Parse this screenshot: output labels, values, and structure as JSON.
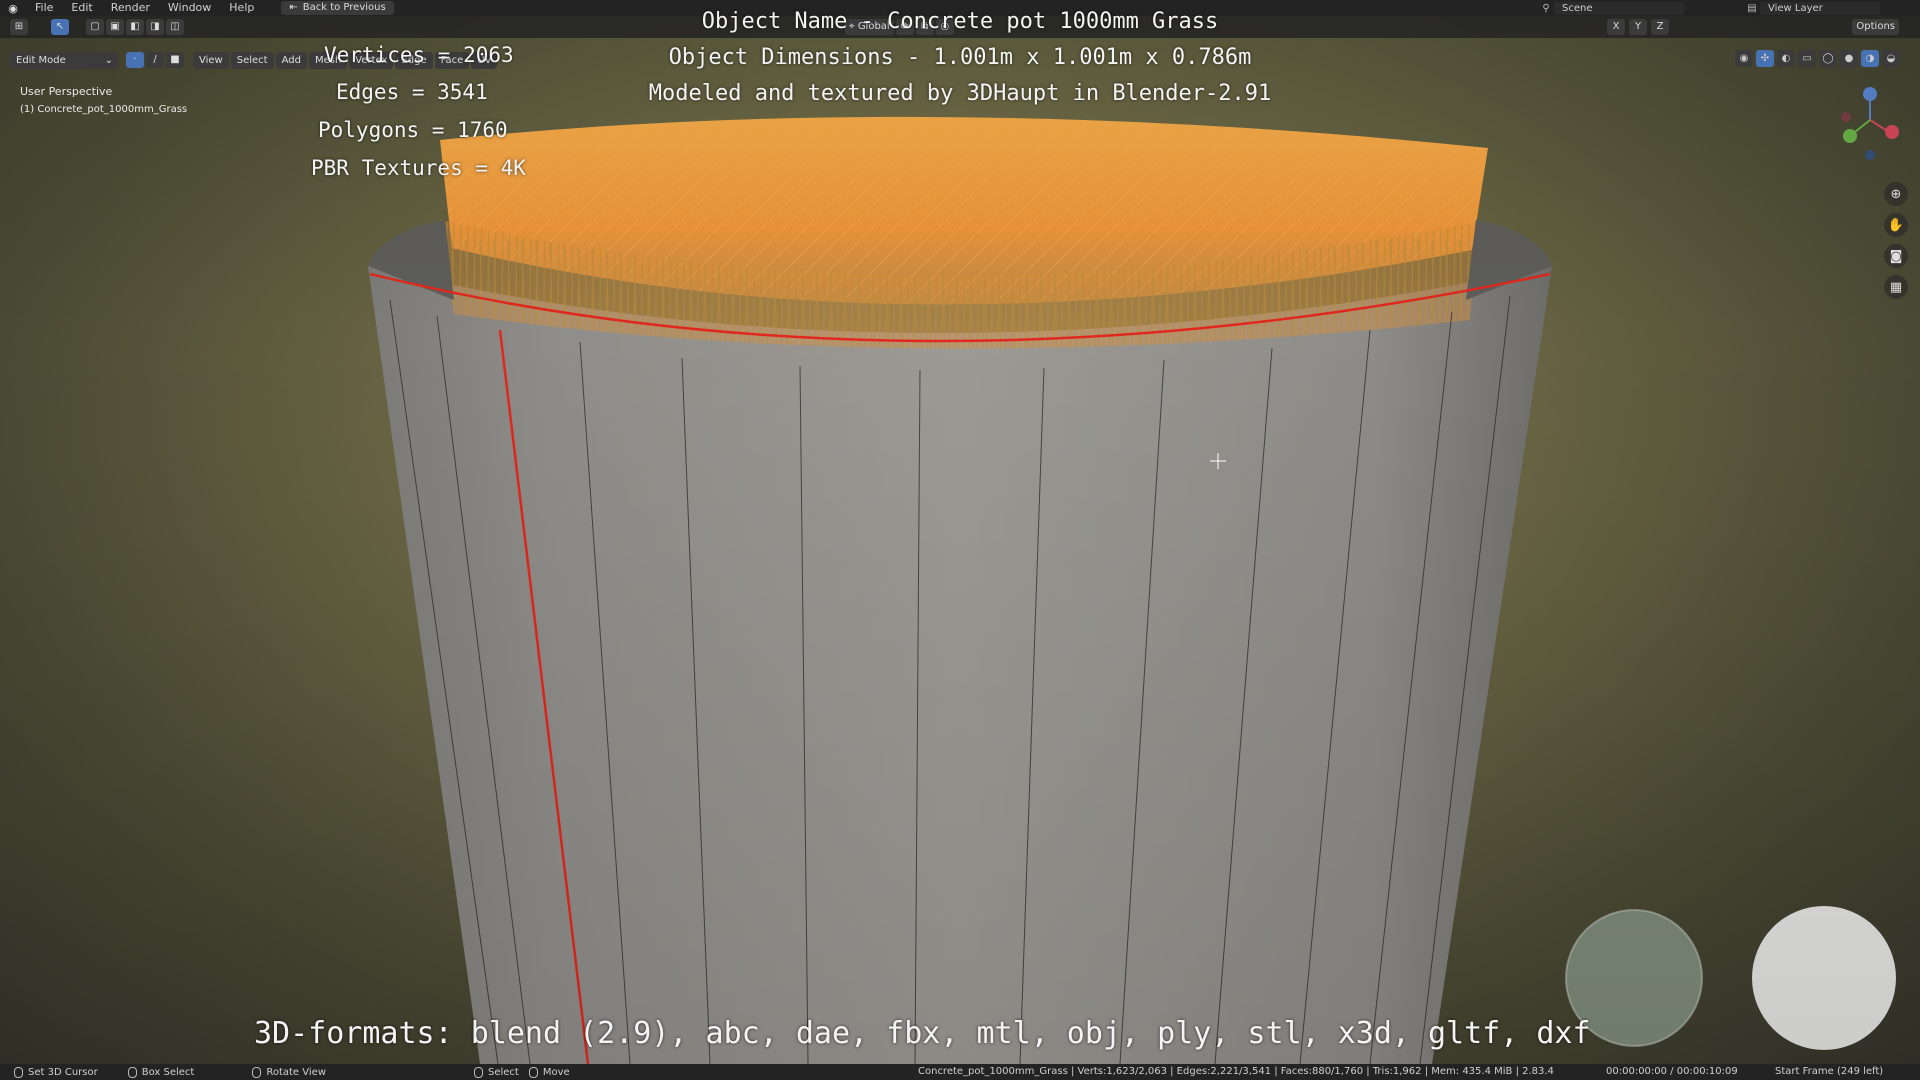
{
  "topbar": {
    "menu": [
      "File",
      "Edit",
      "Render",
      "Window",
      "Help"
    ],
    "back_label": "Back to Previous",
    "scene_label": "Scene",
    "view_layer_label": "View Layer"
  },
  "header": {
    "transform_orientation": "Global",
    "options_label": "Options",
    "axes": [
      "X",
      "Y",
      "Z"
    ]
  },
  "editor": {
    "mode": "Edit Mode",
    "menus": [
      "View",
      "Select",
      "Add",
      "Mesh",
      "Vertex",
      "Edge",
      "Face",
      "UV"
    ]
  },
  "viewport": {
    "perspective": "User Perspective",
    "object": "(1) Concrete_pot_1000mm_Grass"
  },
  "overlay": {
    "object_name": "Object Name - Concrete pot 1000mm Grass",
    "dimensions": "Object Dimensions -  1.001m x 1.001m x 0.786m",
    "credit": "Modeled and textured by 3DHaupt in Blender-2.91",
    "vertices": "Vertices = 2063",
    "edges": "Edges = 3541",
    "polygons": "Polygons = 1760",
    "textures": "PBR Textures = 4K",
    "formats": "3D-formats: blend (2.9), abc, dae, fbx, mtl, obj, ply, stl, x3d, gltf, dxf"
  },
  "statusbar": {
    "hint1": "Set 3D Cursor",
    "hint2": "Box Select",
    "hint3": "Rotate View",
    "hint4": "Select",
    "hint5": "Move",
    "stats": "Concrete_pot_1000mm_Grass | Verts:1,623/2,063 | Edges:2,221/3,541 | Faces:880/1,760 | Tris:1,962 | Mem: 435.4 MiB | 2.83.4",
    "time": "00:00:00:00 / 00:00:10:09",
    "frame": "Start Frame (249 left)"
  },
  "colors": {
    "accent": "#4772b3",
    "selection": "#ff8a1f",
    "seam": "#e0281e"
  }
}
